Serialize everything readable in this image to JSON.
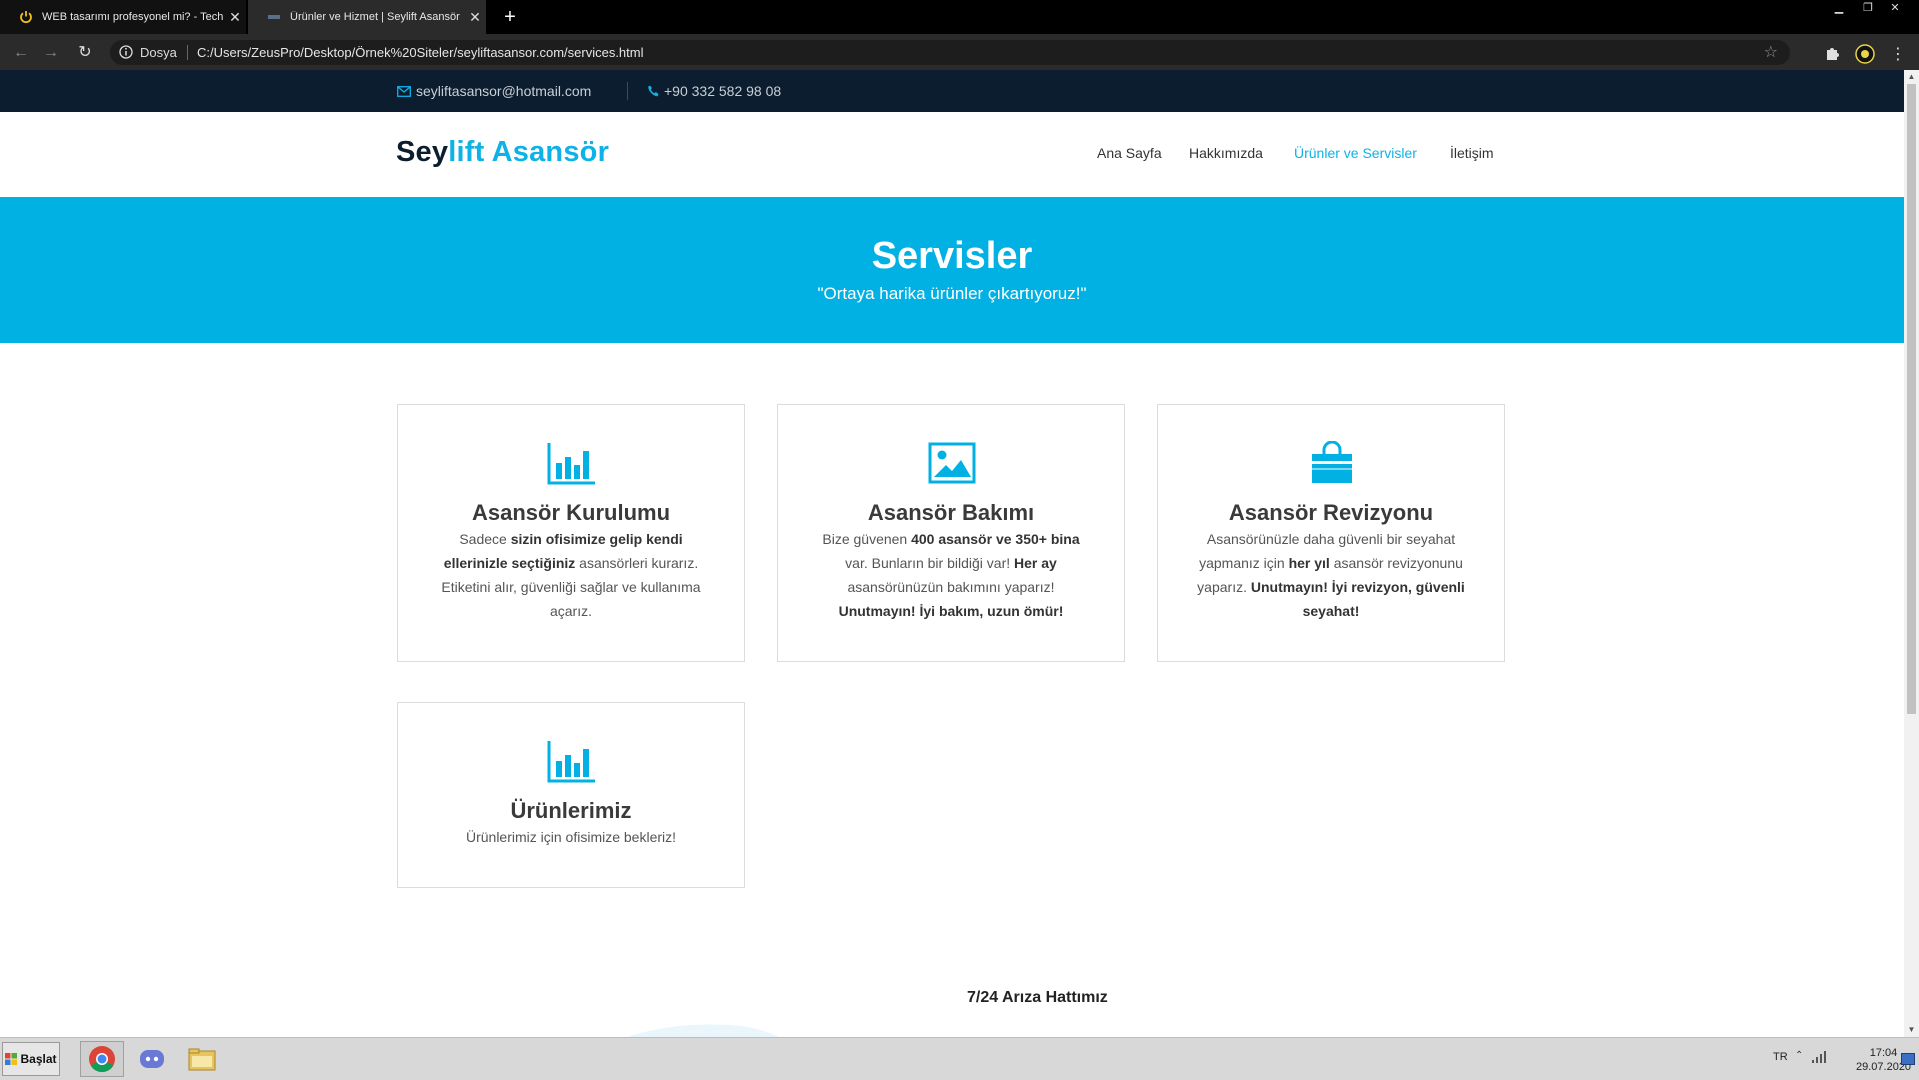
{
  "browser": {
    "tabs": [
      {
        "title": "WEB tasarımı profesyonel mi? - Tech",
        "active": false
      },
      {
        "title": "Ürünler ve Hizmet | Seylift Asansör",
        "active": true
      }
    ],
    "address": {
      "label": "Dosya",
      "url": "C:/Users/ZeusPro/Desktop/Örnek%20Siteler/seyliftasansor.com/services.html"
    }
  },
  "site": {
    "topbar": {
      "email": "seyliftasansor@hotmail.com",
      "phone": "+90 332 582 98 08"
    },
    "logo": {
      "part1": "Sey",
      "part2": "lift Asansör"
    },
    "nav": [
      {
        "label": "Ana Sayfa",
        "active": false
      },
      {
        "label": "Hakkımızda",
        "active": false
      },
      {
        "label": "Ürünler ve Servisler",
        "active": true
      },
      {
        "label": "İletişim",
        "active": false
      }
    ],
    "hero": {
      "title": "Servisler",
      "subtitle": "\"Ortaya harika ürünler çıkartıyoruz!\""
    },
    "cards": [
      {
        "icon": "bar-chart-icon",
        "title": "Asansör Kurulumu",
        "text": [
          [
            "Sadece ",
            false
          ],
          [
            "sizin ofisimize gelip kendi ellerinizle seçtiğiniz",
            true
          ],
          [
            " asansörleri kurarız. Etiketini alır, güvenliği sağlar ve kullanıma açarız.",
            false
          ]
        ]
      },
      {
        "icon": "picture-icon",
        "title": "Asansör Bakımı",
        "text": [
          [
            "Bize güvenen ",
            false
          ],
          [
            "400 asansör ve 350+ bina",
            true
          ],
          [
            " var. Bunların bir bildiği var! ",
            false
          ],
          [
            "Her ay",
            true
          ],
          [
            " asansörünüzün bakımını yaparız! ",
            false
          ],
          [
            "Unutmayın! İyi bakım, uzun ömür!",
            true
          ]
        ]
      },
      {
        "icon": "shopping-bag-icon",
        "title": "Asansör Revizyonu",
        "text": [
          [
            "Asansörünüzle daha güvenli bir seyahat yapmanız için ",
            false
          ],
          [
            "her yıl",
            true
          ],
          [
            " asansör revizyonunu yaparız. ",
            false
          ],
          [
            "Unutmayın! İyi revizyon, güvenli seyahat!",
            true
          ]
        ]
      },
      {
        "icon": "bar-chart-icon",
        "title": "Ürünlerimiz",
        "text": [
          [
            "Ürünlerimiz için ofisimize bekleriz!",
            false
          ]
        ]
      }
    ],
    "footer_title": "7/24 Arıza Hattımız"
  },
  "taskbar": {
    "start_label": "Başlat",
    "apps": [
      "chrome-icon",
      "discord-icon",
      "file-explorer-icon"
    ],
    "language": "TR",
    "time": "17:04",
    "date": "29.07.2020"
  },
  "colors": {
    "accent": "#02b1e4",
    "dark": "#0b1d2e"
  }
}
